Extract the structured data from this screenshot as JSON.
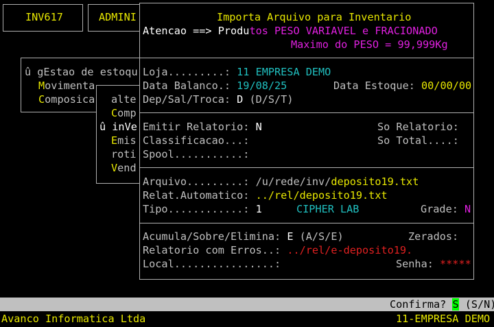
{
  "topbar": {
    "left_code": "INV617",
    "left_menu": "ADMINI"
  },
  "bg_menu": {
    "title": "û gEstao de estoqu",
    "items": [
      {
        "hot": "M",
        "rest": "ovimenta"
      },
      {
        "hot": "C",
        "rest": "omposica"
      }
    ]
  },
  "bg_submenu": {
    "items": [
      {
        "hot": "",
        "rest": "alte"
      },
      {
        "hot": "C",
        "rest": "omp"
      },
      {
        "hot": "",
        "rest": "û inVe",
        "selected": true
      },
      {
        "hot": "E",
        "rest": "mis"
      },
      {
        "hot": "",
        "rest": "roti"
      },
      {
        "hot": "V",
        "rest": "end"
      }
    ]
  },
  "dialog": {
    "title": "Importa Arquivo para Inventario",
    "atencao_label": "Atencao ==> ",
    "atencao_white": "Produ",
    "atencao_magenta": "tos PESO VARIAVEL e FRACIONADO",
    "maximo": "Maximo do PESO = 99,999Kg",
    "loja_label": "Loja.........: ",
    "loja_value": "11 EMPRESA DEMO",
    "data_balanco_label": "Data Balanco.: ",
    "data_balanco_value": "19/08/25",
    "data_estoque_label": "Data Estoque: ",
    "data_estoque_value": "00/00/00",
    "dep_label": "Dep/Sal/Troca: ",
    "dep_value": "D",
    "dep_options": " (D/S/T)",
    "emitir_label": "Emitir Relatorio: ",
    "emitir_value": "N",
    "so_relatorio_label": "So Relatorio:",
    "classificacao_label": "Classificacao...:",
    "so_total_label": "So Total....:",
    "spool_label": "Spool...........:",
    "arquivo_label": "Arquivo.........: ",
    "arquivo_prefix": "/u/rede/inv/",
    "arquivo_file": "deposito19.txt",
    "relat_label": "Relat.Automatico: ",
    "relat_value": "../rel/deposito19.txt",
    "tipo_label": "Tipo............: ",
    "tipo_value": "1",
    "tipo_name": "CIPHER LAB",
    "grade_label": "Grade: ",
    "grade_value": "N",
    "acumula_label": "Acumula/Sobre/Elimina: ",
    "acumula_value": "E",
    "acumula_options": " (A/S/E)",
    "zerados_label": "Zerados:",
    "relerros_label": "Relatorio com Erros..: ",
    "relerros_value": "../rel/e-deposito19.",
    "local_label": "Local................:",
    "senha_label": "Senha: ",
    "senha_value": "*****"
  },
  "status": {
    "confirma_label": "Confirma? ",
    "confirma_value": "S",
    "confirma_options": " (S/N)"
  },
  "footer": {
    "company": "Avanco Informatica Ltda",
    "empresa": "11-EMPRESA DEMO"
  }
}
